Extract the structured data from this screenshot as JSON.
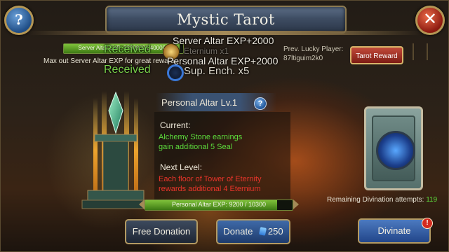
{
  "header": {
    "title": "Mystic Tarot",
    "help_glyph": "?",
    "close_glyph": "✕"
  },
  "server": {
    "bar_label": "Server Altar EXP: 3290000/3400000",
    "bar_progress": 0.97,
    "max_text": "Max out Server Altar EXP for great rewards",
    "prev_label": "Prev. Lucky Player:",
    "prev_name": "87ltiguim2k0",
    "tarot_reward_label": "Tarot Reward"
  },
  "notifications": {
    "received_1": "Received",
    "server_exp": "Server Altar EXP+2000",
    "received_2": "Received",
    "personal_exp": "Personal Altar EXP+2000",
    "ench_text": "Sup. Ench. x5",
    "ghost_text": "Eternium x1"
  },
  "altar": {
    "title": "Personal Altar Lv.1",
    "help_glyph": "?",
    "current_label": "Current:",
    "current_line_1": "Alchemy Stone earnings",
    "current_line_2": "gain additional 5 Seal",
    "next_label": "Next Level:",
    "next_line_1": "Each floor of Tower of Eternity",
    "next_line_2": "rewards additional 4 Eternium",
    "exp_label": "Personal Altar EXP: 9200 / 10300",
    "exp_progress": 0.893
  },
  "divination": {
    "remaining_label": "Remaining Divination attempts:",
    "remaining_count": "119"
  },
  "buttons": {
    "free_donation": "Free Donation",
    "donate": "Donate",
    "donate_cost": "250",
    "divinate": "Divinate",
    "divinate_badge": "!"
  },
  "icons": {
    "medal": "gold-medal-icon",
    "enchant": "enchant-stone-icon",
    "gem": "blue-gem-icon",
    "card": "tarot-card-icon"
  },
  "colors": {
    "green_text": "#5ddc3c",
    "red_text": "#e8342a",
    "title_bar": "#3e4d63",
    "accent_gold": "#b39a62"
  }
}
